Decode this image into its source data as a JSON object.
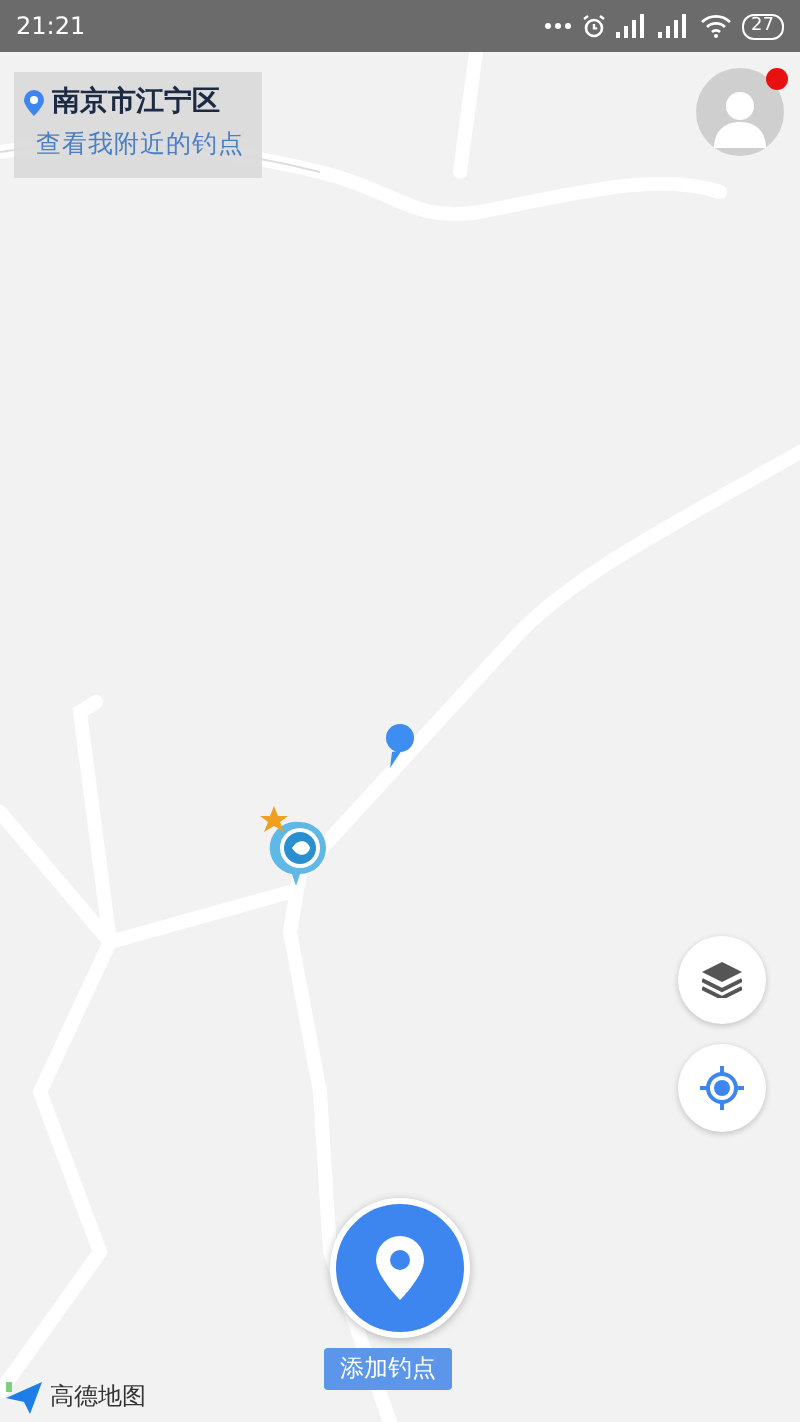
{
  "status_bar": {
    "time": "21:21",
    "battery": "27"
  },
  "location_card": {
    "city": "南京市江宁区",
    "link": "查看我附近的钓点"
  },
  "add_spot": {
    "label": "添加钓点"
  },
  "map_logo": {
    "label": "高德地图"
  }
}
